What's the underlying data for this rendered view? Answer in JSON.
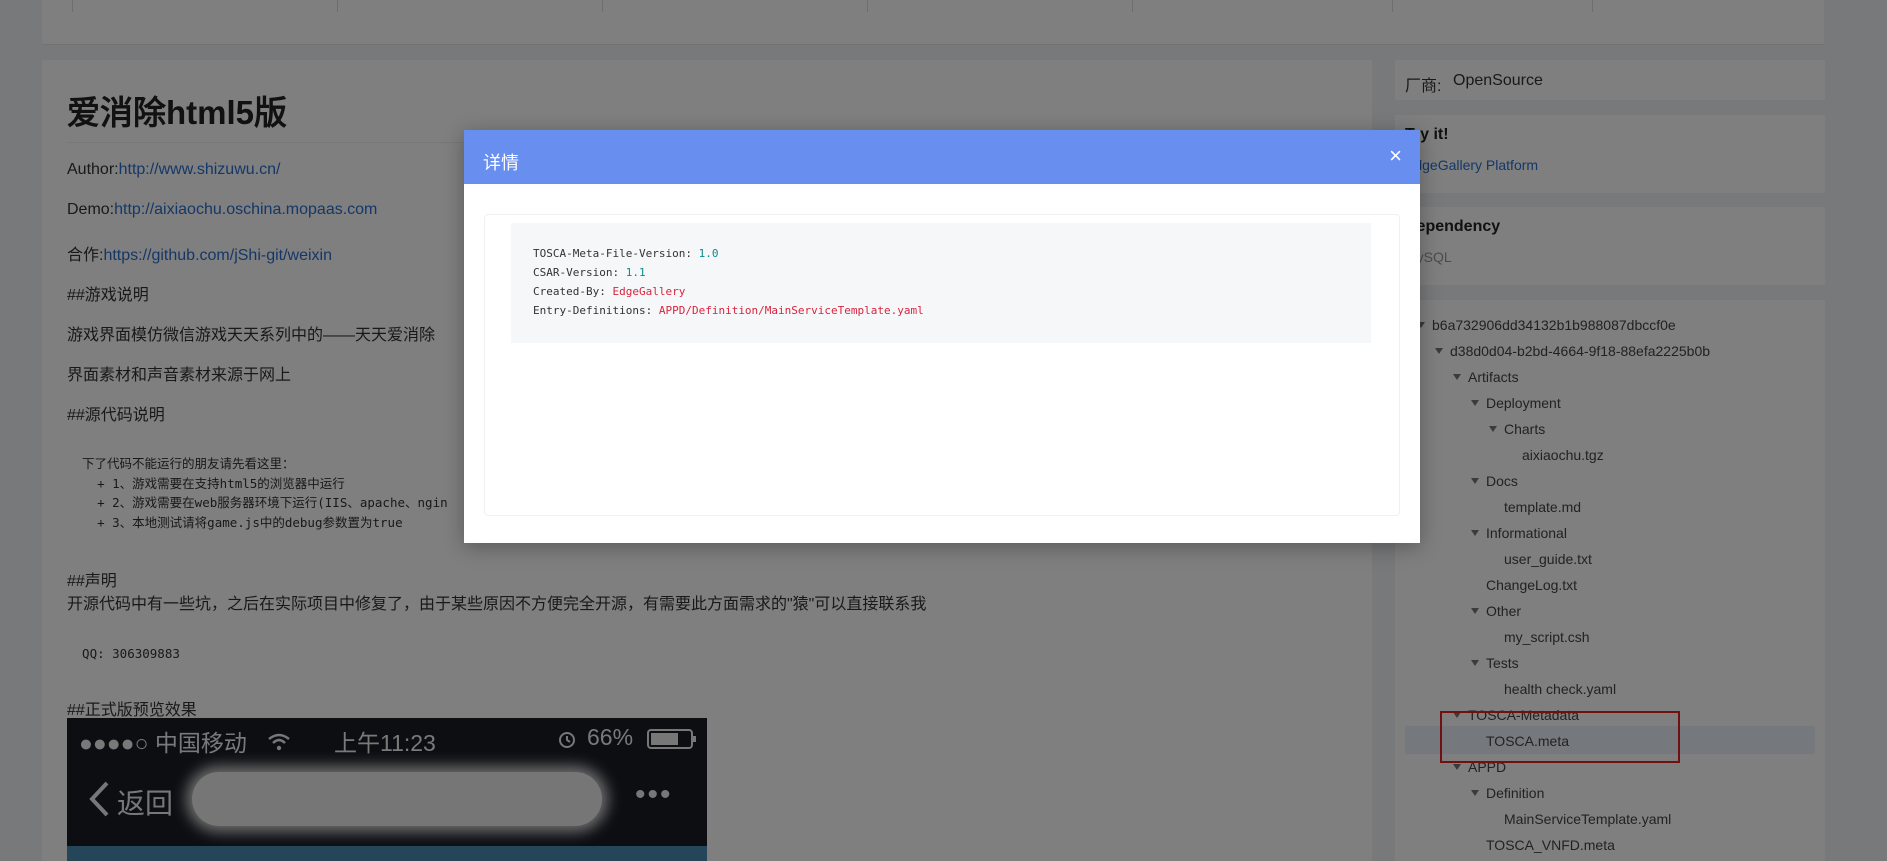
{
  "article": {
    "title": "爱消除html5版",
    "author_label": "Author:",
    "author_link": "http://www.shizuwu.cn/",
    "demo_label": "Demo:",
    "demo_link": "http://aixiaochu.oschina.mopaas.com",
    "coop_label": "合作:",
    "coop_link": "https://github.com/jShi-git/weixin",
    "game_heading": "##游戏说明",
    "game_desc1": "游戏界面模仿微信游戏天天系列中的——天天爱消除",
    "game_desc2": "界面素材和声音素材来源于网上",
    "source_heading": "##源代码说明",
    "code_block": "  下了代码不能运行的朋友请先看这里：\n    + 1、游戏需要在支持html5的浏览器中运行\n    + 2、游戏需要在web服务器环境下运行(IIS、apache、ngin\n    + 3、本地测试请将game.js中的debug参数置为true",
    "statement_heading": "##声明",
    "statement_text": "开源代码中有一些坑，之后在实际项目中修复了，由于某些原因不方便完全开源，有需要此方面需求的\"猿\"可以直接联系我",
    "qq": "  QQ: 306309883",
    "preview_heading": "##正式版预览效果",
    "phone": {
      "carrier": "●●●●○ 中国移动",
      "time": "上午11:23",
      "battery": "66%",
      "back": "返回",
      "more": "•••"
    }
  },
  "sidebar": {
    "vendor_label": "厂商:",
    "vendor_value": "OpenSource",
    "try_title": "Try it!",
    "try_link": "EdgeGallery Platform",
    "dependency_title": "Dependency",
    "dependency_value": "MySQL"
  },
  "tree": {
    "nodes": [
      {
        "label": "b6a732906dd34132b1b988087dbccf0e",
        "level": 0,
        "expanded": true
      },
      {
        "label": "d38d0d04-b2bd-4664-9f18-88efa2225b0b",
        "level": 1,
        "expanded": true
      },
      {
        "label": "Artifacts",
        "level": 2,
        "expanded": true
      },
      {
        "label": "Deployment",
        "level": 3,
        "expanded": true
      },
      {
        "label": "Charts",
        "level": 4,
        "expanded": true
      },
      {
        "label": "aixiaochu.tgz",
        "level": 5,
        "expanded": false
      },
      {
        "label": "Docs",
        "level": 3,
        "expanded": true
      },
      {
        "label": "template.md",
        "level": 4,
        "expanded": false
      },
      {
        "label": "Informational",
        "level": 3,
        "expanded": true
      },
      {
        "label": "user_guide.txt",
        "level": 4,
        "expanded": false
      },
      {
        "label": "ChangeLog.txt",
        "level": 3,
        "expanded": false
      },
      {
        "label": "Other",
        "level": 3,
        "expanded": true
      },
      {
        "label": "my_script.csh",
        "level": 4,
        "expanded": false
      },
      {
        "label": "Tests",
        "level": 3,
        "expanded": true
      },
      {
        "label": "health check.yaml",
        "level": 4,
        "expanded": false
      },
      {
        "label": "TOSCA-Metadata",
        "level": 2,
        "expanded": true
      },
      {
        "label": "TOSCA.meta",
        "level": 3,
        "expanded": false
      },
      {
        "label": "APPD",
        "level": 2,
        "expanded": true
      },
      {
        "label": "Definition",
        "level": 3,
        "expanded": true
      },
      {
        "label": "MainServiceTemplate.yaml",
        "level": 4,
        "expanded": false
      },
      {
        "label": "TOSCA_VNFD.meta",
        "level": 3,
        "expanded": false
      }
    ],
    "selected": "TOSCA.meta"
  },
  "dialog": {
    "title": "详情",
    "close": "×",
    "lines": [
      {
        "key": "TOSCA-Meta-File-Version:",
        "value": "1.0",
        "kind": "num"
      },
      {
        "key": "CSAR-Version:",
        "value": "1.1",
        "kind": "num"
      },
      {
        "key": "Created-By:",
        "value": "EdgeGallery",
        "kind": "str"
      },
      {
        "key": "Entry-Definitions:",
        "value": "APPD/Definition/MainServiceTemplate.yaml",
        "kind": "str"
      }
    ]
  }
}
